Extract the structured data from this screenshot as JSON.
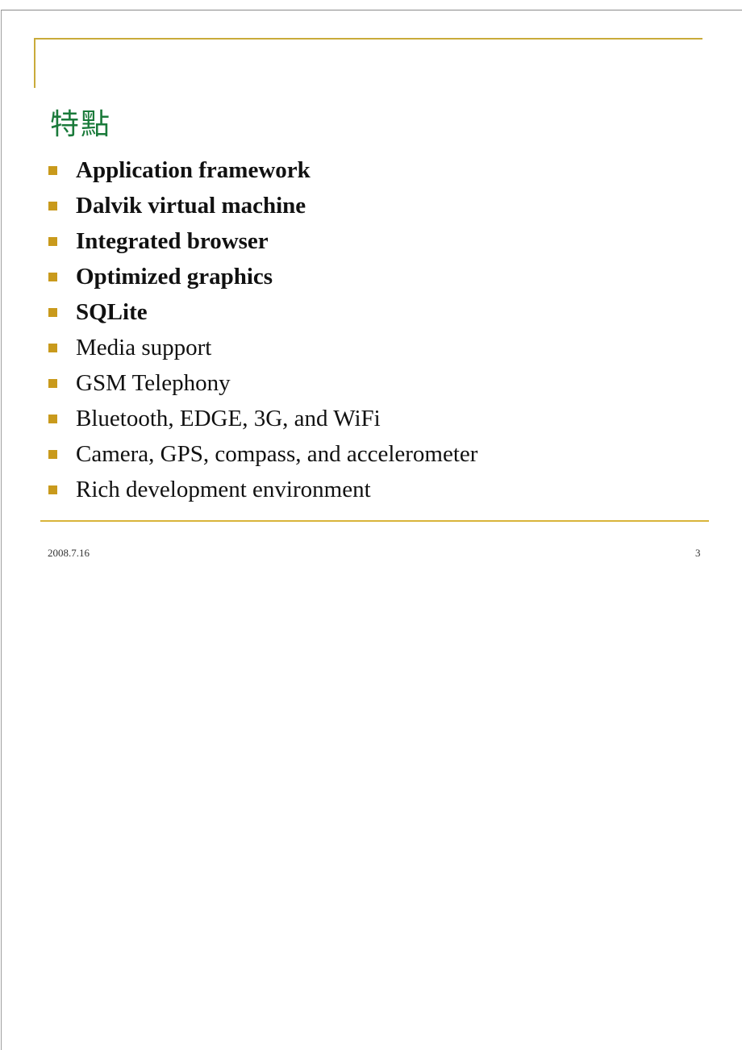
{
  "slide": {
    "title": "特點",
    "bullets": [
      {
        "text": "Application framework"
      },
      {
        "text": "Dalvik virtual machine"
      },
      {
        "text": "Integrated browser"
      },
      {
        "text": "Optimized graphics"
      },
      {
        "text": "SQLite"
      },
      {
        "text": "Media support"
      },
      {
        "text": "GSM Telephony"
      },
      {
        "text": "Bluetooth, EDGE, 3G, and WiFi"
      },
      {
        "text": "Camera, GPS, compass, and accelerometer"
      },
      {
        "text": "Rich development environment"
      }
    ],
    "footer": {
      "date": "2008.7.16",
      "page_number": "3"
    }
  },
  "colors": {
    "accent": "#c9ab3a",
    "bullet_marker": "#c99a1c",
    "title": "#1a7a3a"
  }
}
